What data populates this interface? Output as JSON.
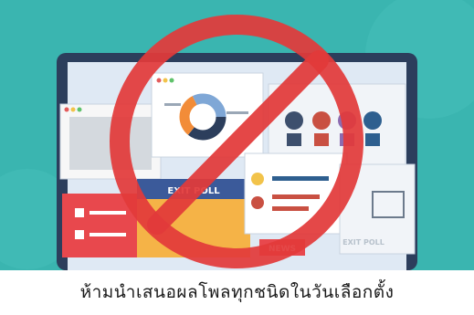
{
  "illustration": {
    "exit_poll_label": "EXIT POLL",
    "news_label": "NEWS",
    "exit_poll_faded_label": "EXIT POLL",
    "ban_sign_icon": "prohibition-sign-icon",
    "pie_chart_icon": "donut-chart-icon",
    "people_icons": "candidate-avatars-icon",
    "colors": {
      "background": "#3ab5b0",
      "prohibition": "#e23a3a",
      "laptop_frame": "#2c3e5c",
      "screen_bg": "#dfe9f4"
    }
  },
  "caption": {
    "text": "ห้ามนำเสนอผลโพลทุกชนิดในวันเลือกตั้ง"
  }
}
